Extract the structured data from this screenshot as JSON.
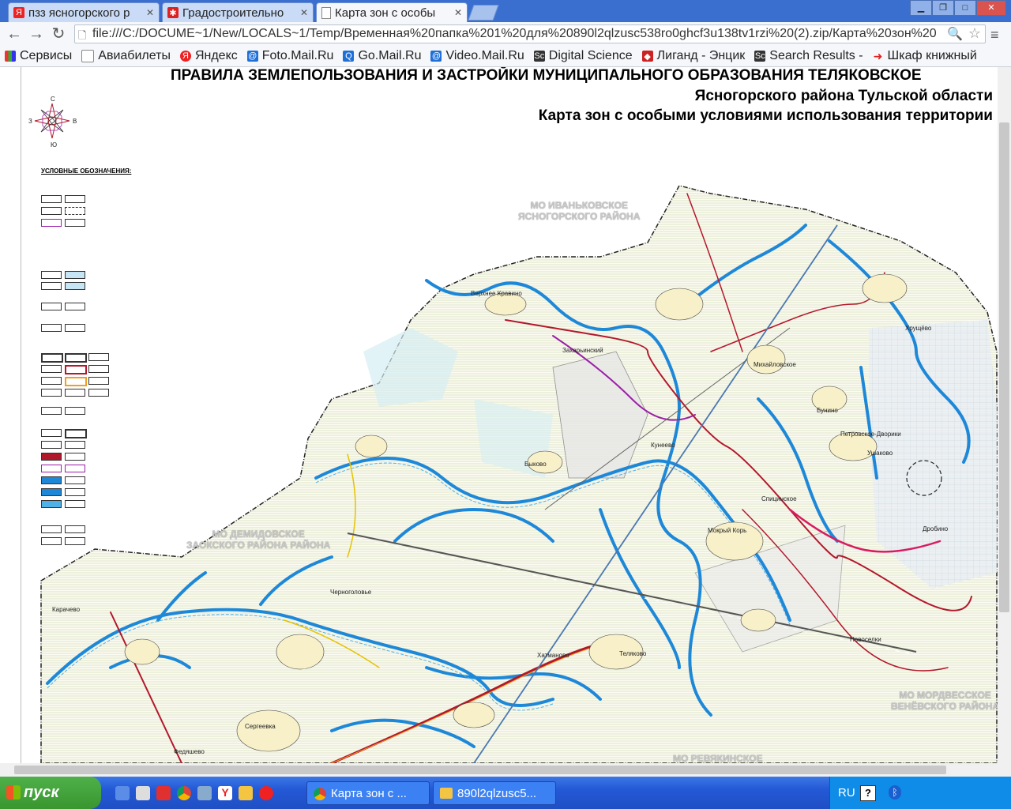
{
  "tabs": [
    {
      "label": "пзз ясногорского р",
      "icon": "yandex-icon"
    },
    {
      "label": "Градостроительно",
      "icon": "site-icon"
    },
    {
      "label": "Карта зон с особы",
      "icon": "document-icon",
      "active": true
    }
  ],
  "address_bar": {
    "url": "file:///C:/DOCUME~1/New/LOCALS~1/Temp/Временная%20папка%201%20для%20890l2qlzusc538ro0ghcf3u138tv1rzi%20(2).zip/Карта%20зон%20"
  },
  "bookmarks": [
    {
      "label": "Сервисы",
      "icon": "apps-icon"
    },
    {
      "label": "Авиабилеты",
      "icon": "page-icon"
    },
    {
      "label": "Яндекс",
      "icon": "yandex-icon"
    },
    {
      "label": "Foto.Mail.Ru",
      "icon": "mailru-icon"
    },
    {
      "label": "Go.Mail.Ru",
      "icon": "search-icon"
    },
    {
      "label": "Video.Mail.Ru",
      "icon": "mailru-icon"
    },
    {
      "label": "Digital Science",
      "icon": "sc-icon"
    },
    {
      "label": "Лиганд - Энцик",
      "icon": "ligand-icon"
    },
    {
      "label": "Search Results -",
      "icon": "sc-icon"
    },
    {
      "label": "Шкаф книжный",
      "icon": "arrow-icon"
    }
  ],
  "document": {
    "title_line1": "ПРАВИЛА ЗЕМЛЕПОЛЬЗОВАНИЯ И ЗАСТРОЙКИ МУНИЦИПАЛЬНОГО ОБРАЗОВАНИЯ ТЕЛЯКОВСКОЕ",
    "title_line2": "Ясногорского района Тульской области",
    "title_line3": "Карта зон с особыми условиями использования территории",
    "legend_title": "УСЛОВНЫЕ ОБОЗНАЧЕНИЯ:",
    "compass": {
      "n": "С",
      "s": "Ю",
      "w": "З",
      "e": "В"
    },
    "neighbors": [
      {
        "line1": "МО ИВАНЬКОВСКОЕ",
        "line2": "ЯСНОГОРСКОГО РАЙОНА"
      },
      {
        "line1": "МО ДЕМИДОВСКОЕ",
        "line2": "ЗАОКСКОГО РАЙОНА РАЙОНА"
      },
      {
        "line1": "МО МОРДВЕССКОЕ",
        "line2": "ВЕНЁВСКОГО РАЙОНА"
      },
      {
        "line1": "МО РЕВЯКИНСКОЕ",
        "line2": ""
      }
    ],
    "places": [
      "Верхнее Кравино",
      "Захарьинский",
      "Михайловское",
      "Кунеево",
      "Петровское-Дворики",
      "Хрущёво",
      "Спицинское",
      "Мокрый Корь",
      "Теляково",
      "Новоселки",
      "Черноголовье",
      "Карачево",
      "Быково",
      "Дробино",
      "Хатманово",
      "Ушаково",
      "Бунино",
      "Сергеевка",
      "Федяшево"
    ]
  },
  "taskbar": {
    "start_label": "пуск",
    "tasks": [
      {
        "label": "Карта зон с ...",
        "icon": "chrome-icon"
      },
      {
        "label": "890l2qlzusc5...",
        "icon": "folder-icon"
      }
    ],
    "lang": "RU"
  },
  "colors": {
    "titlebar": "#3a6fd0",
    "river": "#1e88d8",
    "road": "#b2182b",
    "boundary": "#9b1fa8",
    "taskbar": "#2458d6",
    "start": "#3a962f"
  }
}
